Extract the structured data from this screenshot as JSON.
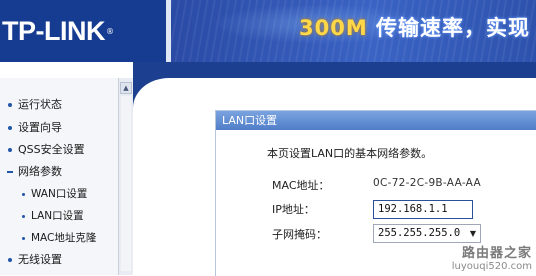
{
  "header": {
    "logo": "TP-LINK",
    "logo_mark": "®",
    "banner_speed": "300M",
    "banner_text": "传输速率，实现"
  },
  "nav": {
    "items": [
      {
        "label": "运行状态",
        "type": "item"
      },
      {
        "label": "设置向导",
        "type": "item"
      },
      {
        "label": "QSS安全设置",
        "type": "item"
      },
      {
        "label": "网络参数",
        "type": "expanded"
      },
      {
        "label": "WAN口设置",
        "type": "sub"
      },
      {
        "label": "LAN口设置",
        "type": "sub"
      },
      {
        "label": "MAC地址克隆",
        "type": "sub"
      },
      {
        "label": "无线设置",
        "type": "item"
      }
    ]
  },
  "panel": {
    "title": "LAN口设置",
    "intro": "本页设置LAN口的基本网络参数。",
    "mac_label": "MAC地址：",
    "mac_value": "0C-72-2C-9B-AA-AA",
    "ip_label": "IP地址：",
    "ip_value": "192.168.1.1",
    "mask_label": "子网掩码：",
    "mask_value": "255.255.255.0"
  },
  "watermark": {
    "line1": "路由器之家",
    "line2": "luyouqi520.com"
  }
}
